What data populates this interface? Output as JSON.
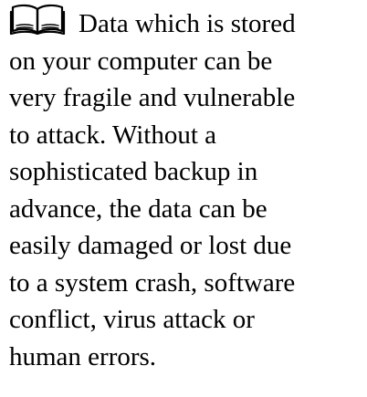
{
  "note": {
    "icon": "open-book-icon",
    "lines": [
      "Data which is stored",
      "on your computer can be",
      "very fragile and vulnerable",
      "to attack. Without a",
      "sophisticated backup in",
      "advance, the data can be",
      "easily damaged or lost due",
      "to a system crash, software",
      "conflict, virus attack or",
      "human errors."
    ]
  }
}
